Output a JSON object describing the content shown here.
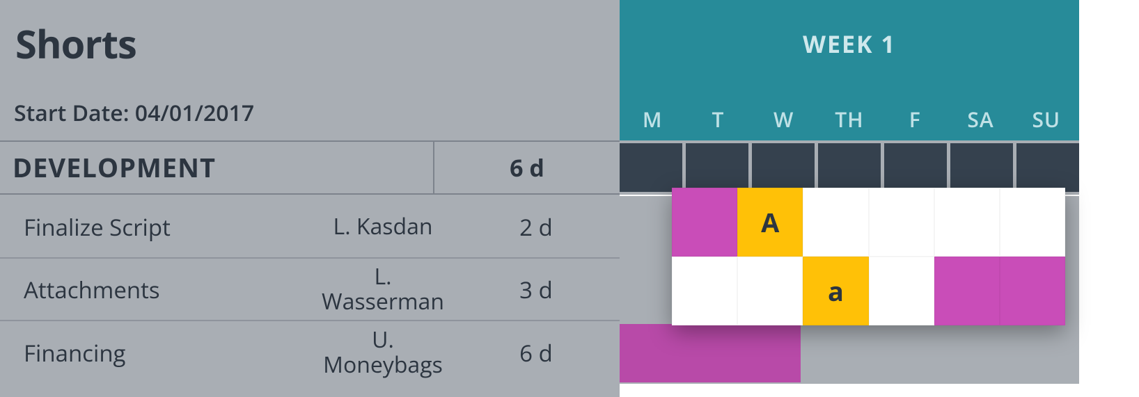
{
  "project": {
    "title": "Shorts",
    "start_date_label": "Start Date: 04/01/2017"
  },
  "section": {
    "name": "DEVELOPMENT",
    "duration": "6 d"
  },
  "tasks": [
    {
      "name": "Finalize Script",
      "owner": "L. Kasdan",
      "duration": "2 d"
    },
    {
      "name": "Attachments",
      "owner": "L.\nWasserman",
      "duration": "3 d"
    },
    {
      "name": "Financing",
      "owner": "U.\nMoneybags",
      "duration": "6 d"
    }
  ],
  "week": {
    "title": "WEEK 1",
    "days": [
      "M",
      "T",
      "W",
      "TH",
      "F",
      "SA",
      "SU"
    ]
  },
  "callout": {
    "row1": {
      "cell_t": "",
      "cell_w": "A",
      "cell_th": "",
      "cell_f": "",
      "cell_sa": "",
      "cell_su": ""
    },
    "row2": {
      "cell_t": "",
      "cell_w": "",
      "cell_th": "a",
      "cell_f": "",
      "cell_sa": "",
      "cell_su": ""
    }
  },
  "colors": {
    "teal": "#278b99",
    "slate": "#35414e",
    "gray_bg": "#a9aeb4",
    "magenta": "#c94db8",
    "yellow": "#ffc107"
  }
}
